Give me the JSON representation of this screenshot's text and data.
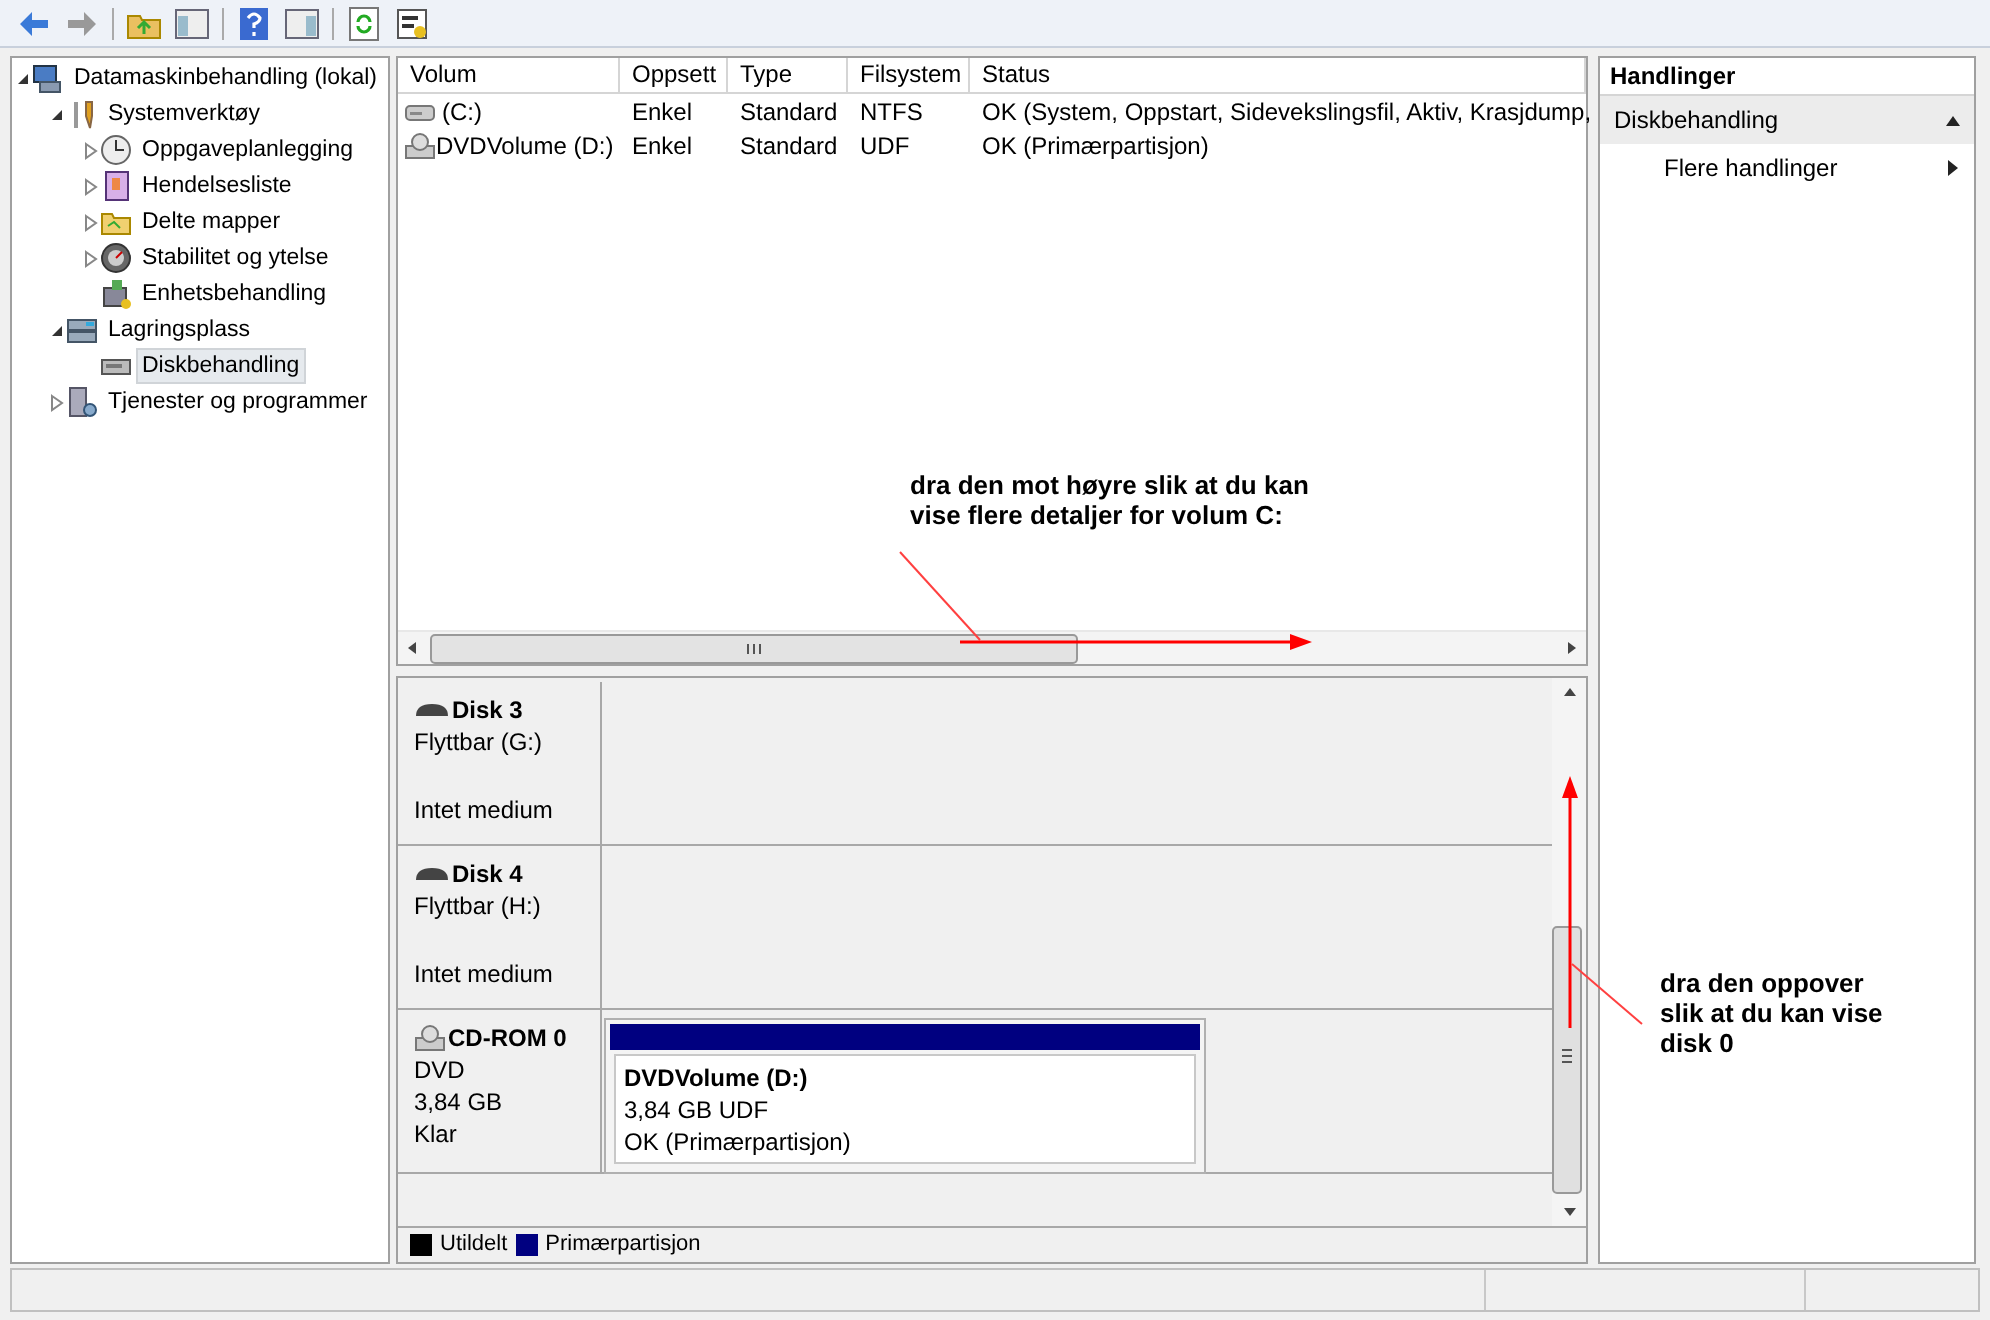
{
  "tree": [
    {
      "label": "Datamaskinbehandling (lokal)",
      "selected": false,
      "expanded": true,
      "children": [
        {
          "label": "Systemverktøy",
          "selected": false,
          "expanded": true,
          "children": [
            {
              "label": "Oppgaveplanlegging",
              "selected": false,
              "expanded": false
            },
            {
              "label": "Hendelsesliste",
              "selected": false,
              "expanded": false
            },
            {
              "label": "Delte mapper",
              "selected": false,
              "expanded": false
            },
            {
              "label": "Stabilitet og ytelse",
              "selected": false,
              "expanded": false
            },
            {
              "label": "Enhetsbehandling",
              "selected": false
            }
          ]
        },
        {
          "label": "Lagringsplass",
          "selected": false,
          "expanded": true,
          "children": [
            {
              "label": "Diskbehandling",
              "selected": true
            }
          ]
        },
        {
          "label": "Tjenester og programmer",
          "selected": false,
          "expanded": false
        }
      ]
    }
  ],
  "volume_table": {
    "columns": [
      "Volum",
      "Oppsett",
      "Type",
      "Filsystem",
      "Status"
    ],
    "rows": [
      {
        "kind": "drive",
        "cells": [
          "(C:)",
          "Enkel",
          "Standard",
          "NTFS",
          "OK (System, Oppstart, Sidevekslingsfil, Aktiv, Krasjdump,"
        ]
      },
      {
        "kind": "optical",
        "cells": [
          "DVDVolume (D:)",
          "Enkel",
          "Standard",
          "UDF",
          "OK (Primærpartisjon)"
        ]
      }
    ]
  },
  "disks": [
    {
      "kind": "removable",
      "name": "Disk 3",
      "type": "Flyttbar (G:)",
      "status": "Intet medium"
    },
    {
      "kind": "removable",
      "name": "Disk 4",
      "type": "Flyttbar (H:)",
      "status": "Intet medium"
    },
    {
      "kind": "optical",
      "name": "CD-ROM 0",
      "type": "DVD",
      "size": "3,84 GB",
      "status": "Klar",
      "partitions": [
        {
          "name": "DVDVolume  (D:)",
          "size": "3,84 GB UDF",
          "status": "OK (Primærpartisjon)",
          "color": "#000080"
        }
      ]
    }
  ],
  "legend": [
    {
      "label": "Utildelt",
      "color": "#000000"
    },
    {
      "label": "Primærpartisjon",
      "color": "#000080"
    }
  ],
  "actions": {
    "title": "Handlinger",
    "sections": [
      {
        "label": "Diskbehandling",
        "expanded": true,
        "items": [
          {
            "label": "Flere handlinger"
          }
        ]
      }
    ]
  },
  "annotations": [
    {
      "text": "dra den mot høyre slik at du kan\nvise flere detaljer for volum C:"
    },
    {
      "text": "dra den oppover\nslik at du kan vise\ndisk 0"
    }
  ]
}
